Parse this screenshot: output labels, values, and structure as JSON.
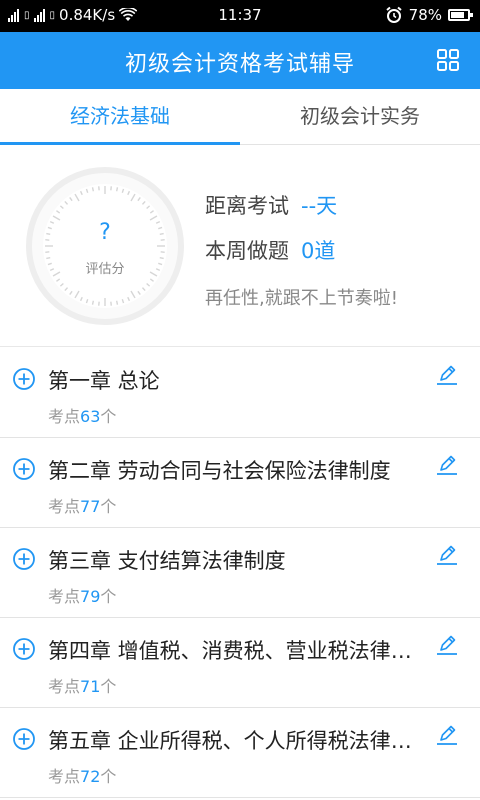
{
  "status_bar": {
    "speed": "0.84K/s",
    "time": "11:37",
    "battery": "78%"
  },
  "header": {
    "title": "初级会计资格考试辅导"
  },
  "tabs": [
    {
      "label": "经济法基础",
      "active": true
    },
    {
      "label": "初级会计实务",
      "active": false
    }
  ],
  "stats": {
    "gauge_value": "?",
    "gauge_label": "评估分",
    "exam_label": "距离考试",
    "exam_value": "--天",
    "week_label": "本周做题",
    "week_value": "0道",
    "slogan": "再任性,就跟不上节奏啦!"
  },
  "chapters": [
    {
      "title": "第一章 总论",
      "prefix": "考点",
      "count": "63",
      "suffix": "个"
    },
    {
      "title": "第二章 劳动合同与社会保险法律制度",
      "prefix": "考点",
      "count": "77",
      "suffix": "个"
    },
    {
      "title": "第三章 支付结算法律制度",
      "prefix": "考点",
      "count": "79",
      "suffix": "个"
    },
    {
      "title": "第四章 增值税、消费税、营业税法律制度",
      "prefix": "考点",
      "count": "71",
      "suffix": "个"
    },
    {
      "title": "第五章 企业所得税、个人所得税法律制度",
      "prefix": "考点",
      "count": "72",
      "suffix": "个"
    }
  ],
  "icons": {
    "menu": "grid-icon",
    "expand": "plus-circle-icon",
    "practice": "pencil-icon"
  },
  "colors": {
    "accent": "#2196f3"
  }
}
